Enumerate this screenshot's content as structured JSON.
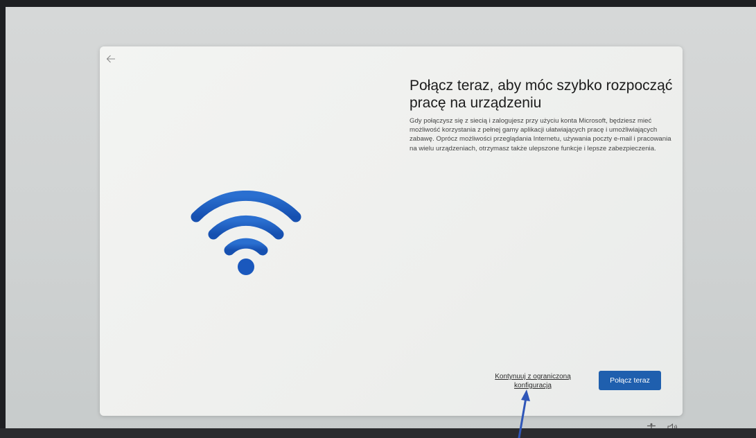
{
  "dialog": {
    "back_icon": "arrow-left-icon",
    "hero_icon": "wifi-icon",
    "title": "Połącz teraz, aby móc szybko rozpocząć pracę na urządzeniu",
    "description": "Gdy połączysz się z siecią i zalogujesz przy użyciu konta Microsoft, będziesz mieć możliwość korzystania z pełnej gamy aplikacji ułatwiających pracę i umożliwiających zabawę. Oprócz możliwości przeglądania Internetu, używania poczty e-mail i pracowania na wielu urządzeniach, otrzymasz także ulepszone funkcje i lepsze zabezpieczenia.",
    "limited_setup_label": "Kontynuuj z ograniczoną konfiguracją",
    "connect_label": "Połącz teraz"
  },
  "tray": {
    "accessibility_icon": "accessibility-icon",
    "volume_icon": "volume-icon"
  },
  "colors": {
    "accent": "#1f5fae",
    "wifi": "#1b5fc2"
  }
}
